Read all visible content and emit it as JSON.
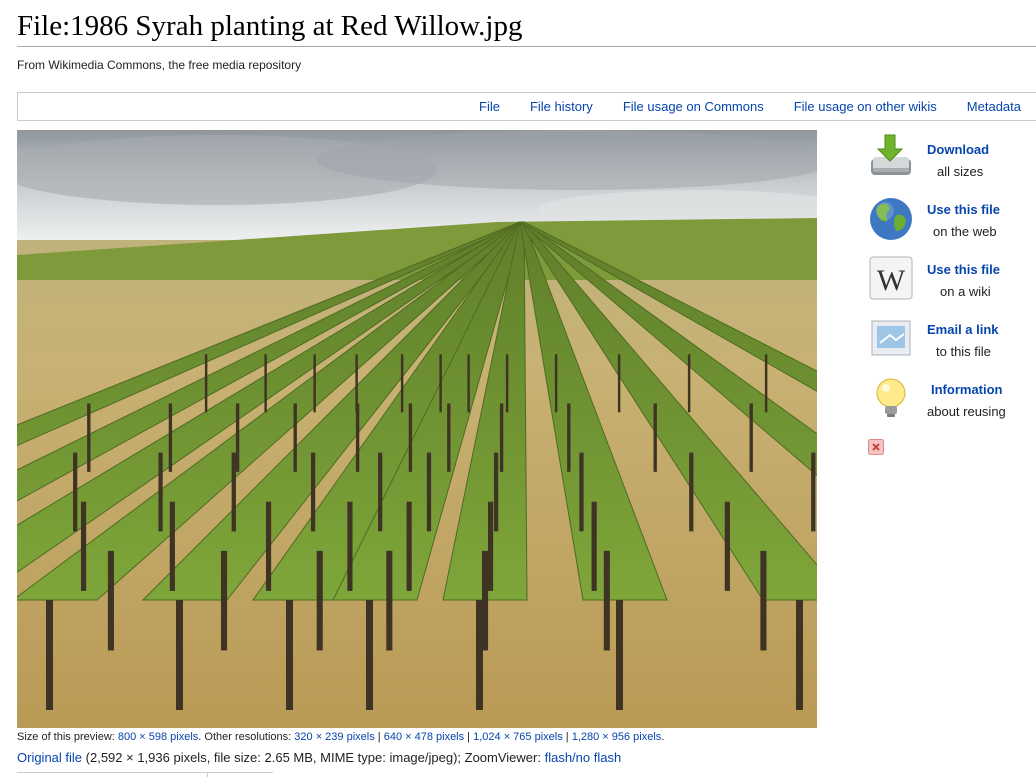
{
  "page": {
    "title": "File:1986 Syrah planting at Red Willow.jpg",
    "tagline": "From Wikimedia Commons, the free media repository"
  },
  "tabs": [
    {
      "label": "File"
    },
    {
      "label": "File history"
    },
    {
      "label": "File usage on Commons"
    },
    {
      "label": "File usage on other wikis"
    },
    {
      "label": "Metadata"
    }
  ],
  "preview": {
    "alt": "1986 Syrah planting at Red Willow.jpg"
  },
  "sidebar": {
    "items": [
      {
        "title": "Download",
        "subtitle": "all sizes",
        "icon": "download-icon"
      },
      {
        "title": "Use this file",
        "subtitle": "on the web",
        "icon": "globe-icon"
      },
      {
        "title": "Use this file",
        "subtitle": "on a wiki",
        "icon": "wikipedia-icon"
      },
      {
        "title": "Email a link",
        "subtitle": "to this file",
        "icon": "email-icon"
      },
      {
        "title": "Information",
        "subtitle": "about reusing",
        "icon": "lightbulb-icon"
      }
    ],
    "close_icon": "close-icon"
  },
  "resolutions": {
    "preview_label": "Size of this preview: ",
    "preview_size": "800 × 598 pixels",
    "other_label": ". Other resolutions: ",
    "sep": " | ",
    "end": ".",
    "options": [
      "320 × 239 pixels",
      "640 × 478 pixels",
      "1,024 × 765 pixels",
      "1,280 × 956 pixels"
    ]
  },
  "original": {
    "link": "Original file",
    "details": " (2,592 × 1,936 pixels, file size: 2.65 MB, MIME type: image/jpeg); ZoomViewer: ",
    "zoom_link": "flash/no flash"
  },
  "colors": {
    "link": "#0645ad",
    "text": "#222222",
    "border": "#a2a9b1"
  }
}
